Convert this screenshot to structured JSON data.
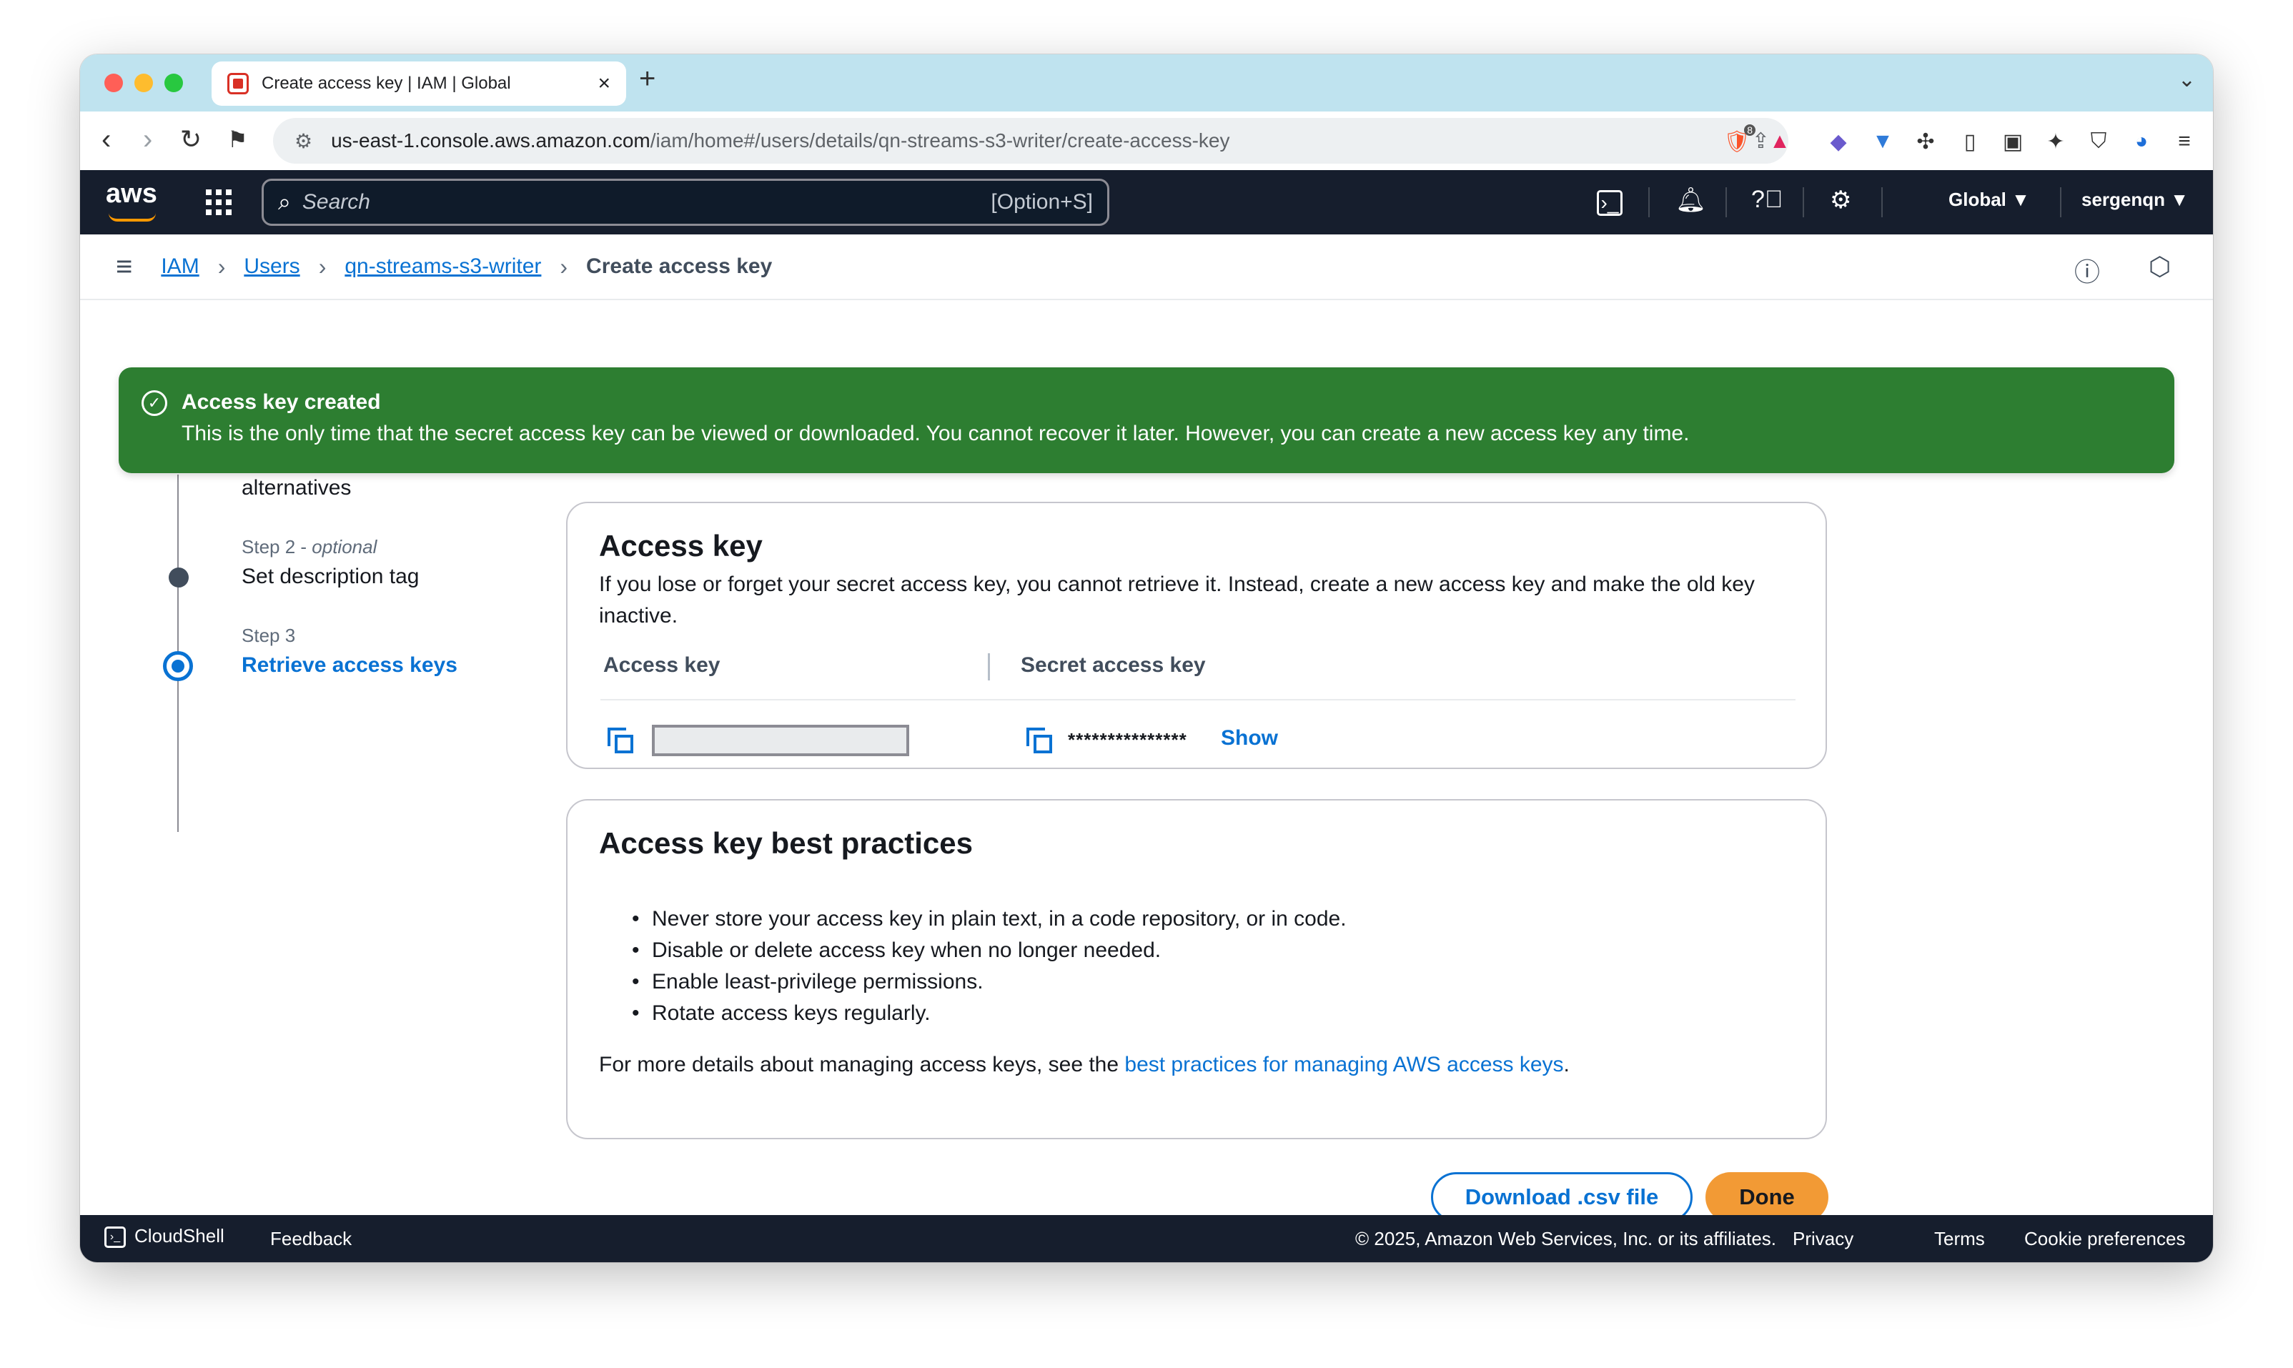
{
  "browser": {
    "tab_title": "Create access key | IAM | Global",
    "url_host": "us-east-1.console.aws.amazon.com",
    "url_path": "/iam/home#/users/details/qn-streams-s3-writer/create-access-key",
    "brave_badge": "8"
  },
  "aws_header": {
    "logo": "aws",
    "search_placeholder": "Search",
    "search_shortcut": "[Option+S]",
    "region": "Global ▼",
    "account": "sergenqn ▼"
  },
  "breadcrumb": {
    "items": [
      "IAM",
      "Users",
      "qn-streams-s3-writer"
    ],
    "current": "Create access key"
  },
  "flash": {
    "title": "Access key created",
    "message": "This is the only time that the secret access key can be viewed or downloaded. You cannot recover it later. However, you can create a new access key any time."
  },
  "steps": {
    "step1_tail": "alternatives",
    "step2_label": "Step 2 - ",
    "step2_optional": "optional",
    "step2_title": "Set description tag",
    "step3_label": "Step 3",
    "step3_title": "Retrieve access keys"
  },
  "access_key_card": {
    "title": "Access key",
    "description": "If you lose or forget your secret access key, you cannot retrieve it. Instead, create a new access key and make the old key inactive.",
    "col_access_key": "Access key",
    "col_secret_key": "Secret access key",
    "secret_masked": "***************",
    "show_label": "Show"
  },
  "best_practices_card": {
    "title": "Access key best practices",
    "items": [
      "Never store your access key in plain text, in a code repository, or in code.",
      "Disable or delete access key when no longer needed.",
      "Enable least-privilege permissions.",
      "Rotate access keys regularly."
    ],
    "more_prefix": "For more details about managing access keys, see the ",
    "more_link": "best practices for managing AWS access keys",
    "more_suffix": "."
  },
  "actions": {
    "download": "Download .csv file",
    "done": "Done"
  },
  "footer": {
    "cloudshell": "CloudShell",
    "feedback": "Feedback",
    "copyright": "© 2025, Amazon Web Services, Inc. or its affiliates.",
    "privacy": "Privacy",
    "terms": "Terms",
    "cookies": "Cookie preferences"
  },
  "colors": {
    "success": "#2d7e31",
    "link": "#0972d3",
    "primary_button": "#f29a35",
    "aws_nav": "#161e2d",
    "tabbar": "#bfe3ef"
  }
}
